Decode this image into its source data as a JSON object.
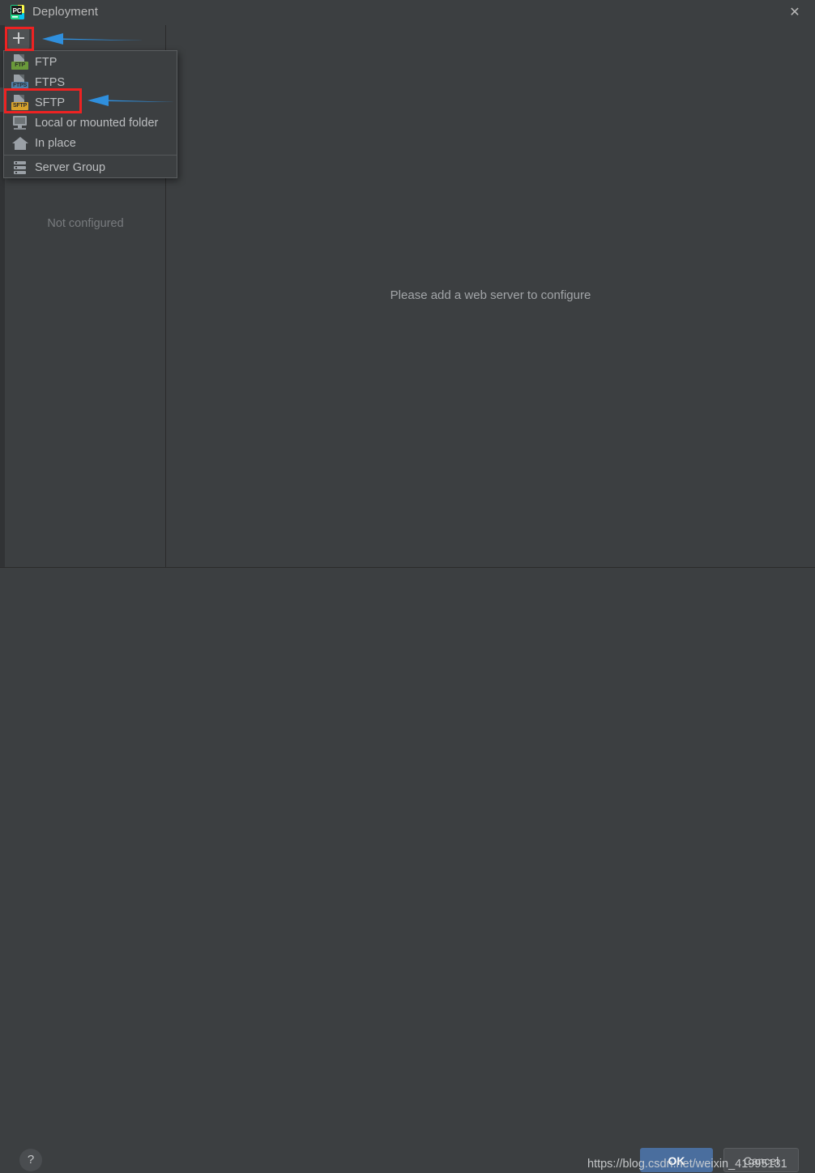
{
  "window": {
    "title": "Deployment",
    "app_icon": "pycharm-icon",
    "close_label": "✕"
  },
  "toolbar": {
    "add_button_label": "+",
    "add_button_icon": "plus-icon"
  },
  "left_panel": {
    "empty_text": "Not configured"
  },
  "content": {
    "message": "Please add a web server to configure"
  },
  "dropdown": {
    "items": [
      {
        "label": "FTP",
        "icon": "ftp-icon",
        "tag": "FTP"
      },
      {
        "label": "FTPS",
        "icon": "ftps-icon",
        "tag": "FTPS"
      },
      {
        "label": "SFTP",
        "icon": "sftp-icon",
        "tag": "SFTP"
      },
      {
        "label": "Local or mounted folder",
        "icon": "monitor-icon"
      },
      {
        "label": "In place",
        "icon": "home-icon"
      },
      {
        "label": "Server Group",
        "icon": "server-group-icon"
      }
    ]
  },
  "footer": {
    "help_label": "?",
    "ok_label": "OK",
    "cancel_label": "Cancel",
    "watermark": "https://blog.csdn.net/weixin_41995131"
  },
  "colors": {
    "dialog_background": "#3c3f41",
    "accent_ok": "#4a6e9e",
    "annotation_red": "#ee2222",
    "annotation_blue": "#2f8fdd",
    "tag_ftp": "#6a9a3a",
    "tag_ftps": "#4f7fa8",
    "tag_sftp": "#d7a22c"
  }
}
